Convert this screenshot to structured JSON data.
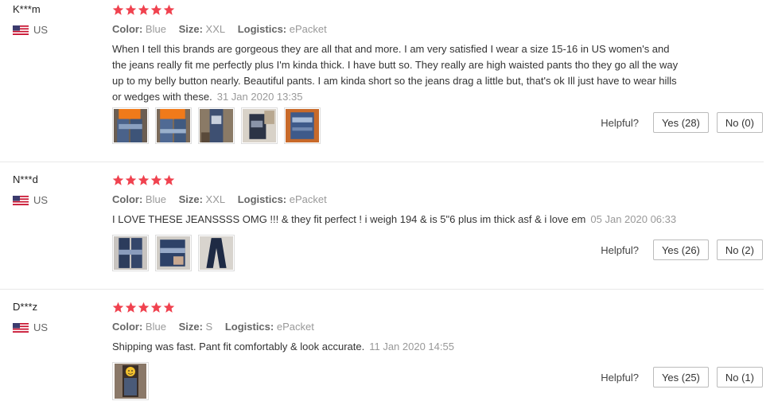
{
  "reviews": [
    {
      "user": "K***m",
      "country": "US",
      "rating": 5,
      "color_label": "Color:",
      "color": "Blue",
      "size_label": "Size:",
      "size": "XXL",
      "logistics_label": "Logistics:",
      "logistics": "ePacket",
      "text": "When I tell this brands are gorgeous they are all that and more. I am very satisfied I wear a size 15-16 in US women's and the jeans really fit me perfectly plus I'm kinda thick. I have butt so. They really are high waisted pants tho they go all the way up to my belly button nearly. Beautiful pants. I am kinda short so the jeans drag a little but, that's ok Ill just have to wear hills or wedges with these.",
      "date": "31 Jan 2020 13:35",
      "photos": [
        "jeans-photo-1",
        "jeans-photo-2",
        "jeans-photo-3",
        "jeans-photo-4",
        "jeans-photo-5"
      ],
      "helpful_label": "Helpful?",
      "yes": "Yes (28)",
      "no": "No (0)"
    },
    {
      "user": "N***d",
      "country": "US",
      "rating": 5,
      "color_label": "Color:",
      "color": "Blue",
      "size_label": "Size:",
      "size": "XXL",
      "logistics_label": "Logistics:",
      "logistics": "ePacket",
      "text": "I LOVE THESE JEANSSSS OMG !!! & they fit perfect ! i weigh 194 & is 5\"6 plus im thick asf & i love em",
      "date": "05 Jan 2020 06:33",
      "photos": [
        "jeans-photo-1",
        "jeans-photo-2",
        "jeans-photo-3"
      ],
      "helpful_label": "Helpful?",
      "yes": "Yes (26)",
      "no": "No (2)"
    },
    {
      "user": "D***z",
      "country": "US",
      "rating": 5,
      "color_label": "Color:",
      "color": "Blue",
      "size_label": "Size:",
      "size": "S",
      "logistics_label": "Logistics:",
      "logistics": "ePacket",
      "text": "Shipping was fast. Pant fit comfortably & look accurate.",
      "date": "11 Jan 2020 14:55",
      "photos": [
        "selfie-photo-1"
      ],
      "helpful_label": "Helpful?",
      "yes": "Yes (25)",
      "no": "No (1)"
    }
  ],
  "colors": {
    "star": "#f0424f",
    "accent": "#e62e04"
  }
}
